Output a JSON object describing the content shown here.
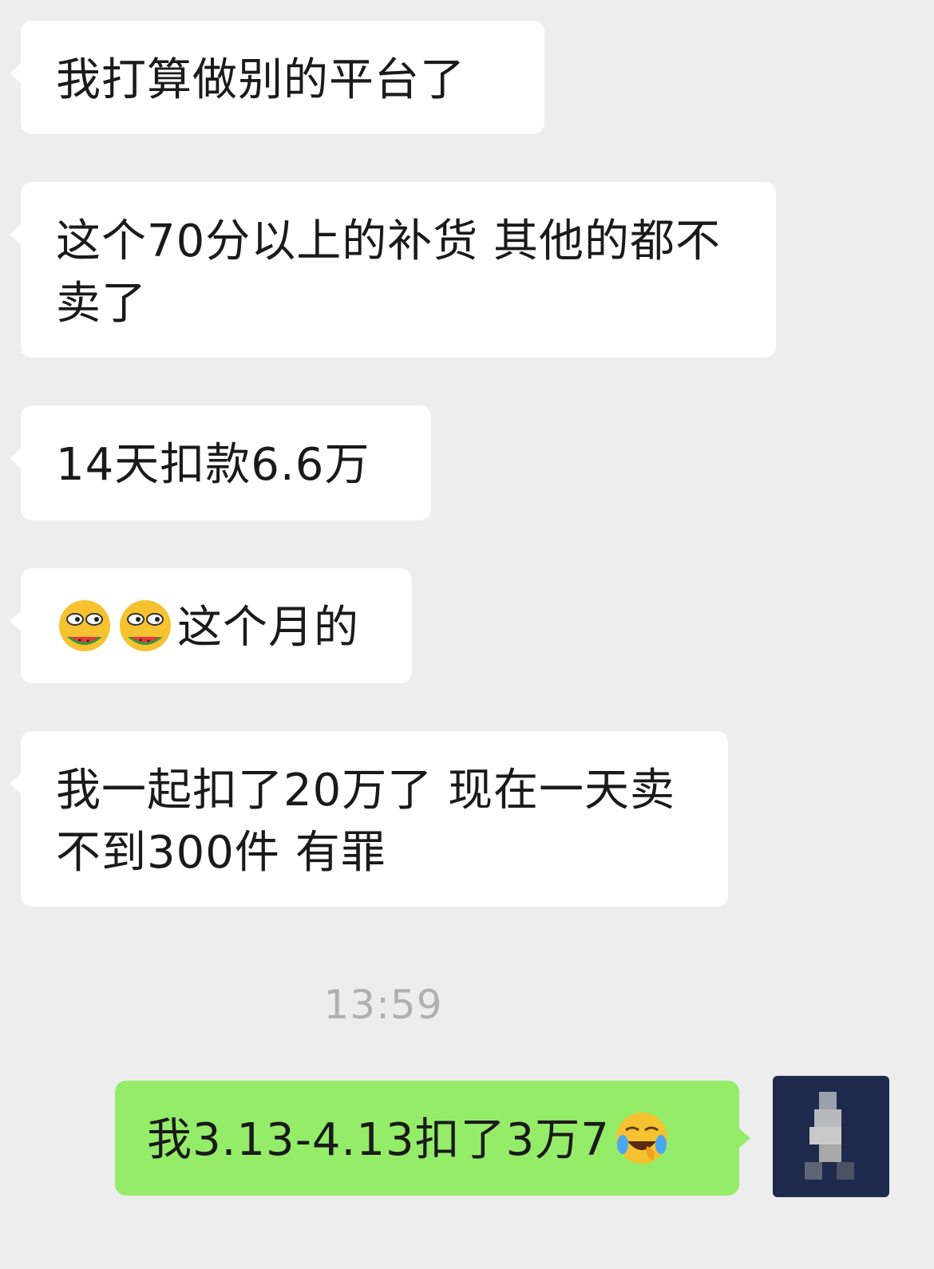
{
  "chat": {
    "messages": [
      {
        "side": "left",
        "text": "我打算做别的平台了"
      },
      {
        "side": "left",
        "text": "这个70分以上的补货 其他的都不卖了"
      },
      {
        "side": "left",
        "text": "14天扣款6.6万"
      },
      {
        "side": "left",
        "emoji": [
          "melon-eating-emoji",
          "melon-eating-emoji"
        ],
        "text": "这个月的"
      },
      {
        "side": "left",
        "text": "我一起扣了20万了 现在一天卖不到300件 有罪"
      },
      {
        "side": "right",
        "text": "我3.13-4.13扣了3万7",
        "emoji_after": "laugh-cry-emoji"
      }
    ],
    "timestamp": "13:59"
  },
  "colors": {
    "background": "#ededed",
    "incoming_bubble": "#ffffff",
    "outgoing_bubble": "#95ec69",
    "timestamp": "#b0b0b0"
  }
}
